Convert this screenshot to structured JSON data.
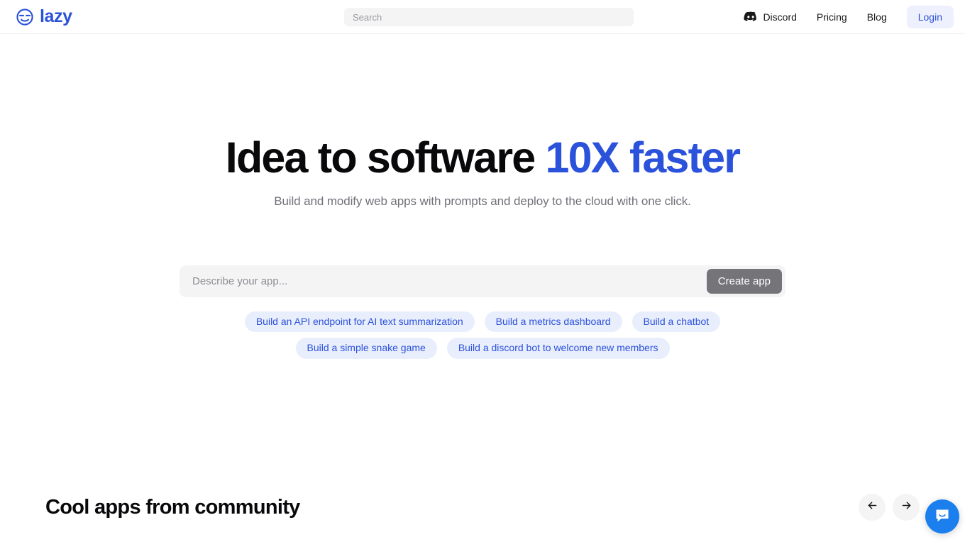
{
  "header": {
    "brand": {
      "name": "lazy",
      "icon": "sleepy-face-logo-icon"
    },
    "search": {
      "placeholder": "Search",
      "value": ""
    },
    "nav": [
      {
        "label": "Discord",
        "icon": "discord-icon"
      },
      {
        "label": "Pricing",
        "icon": ""
      },
      {
        "label": "Blog",
        "icon": ""
      }
    ],
    "login_label": "Login"
  },
  "hero": {
    "title_main": "Idea to software",
    "title_accent": "10X faster",
    "subtitle": "Build and modify web apps with prompts and deploy to the cloud with one click."
  },
  "prompt": {
    "placeholder": "Describe your app...",
    "value": "",
    "create_label": "Create app"
  },
  "suggestions": [
    "Build an API endpoint for AI text summarization",
    "Build a metrics dashboard",
    "Build a chatbot",
    "Build a simple snake game",
    "Build a discord bot to welcome new members"
  ],
  "community": {
    "title": "Cool apps from community",
    "prev_icon": "arrow-left-icon",
    "next_icon": "arrow-right-icon"
  },
  "chat": {
    "icon": "chat-bubble-icon"
  },
  "colors": {
    "accent_blue": "#2b52db",
    "chip_bg": "#e9eefc",
    "field_bg": "#f4f4f5",
    "create_btn_bg": "#757579",
    "chat_blue": "#1c7fee",
    "text_dark": "#09090b",
    "text_muted": "#71717a"
  }
}
